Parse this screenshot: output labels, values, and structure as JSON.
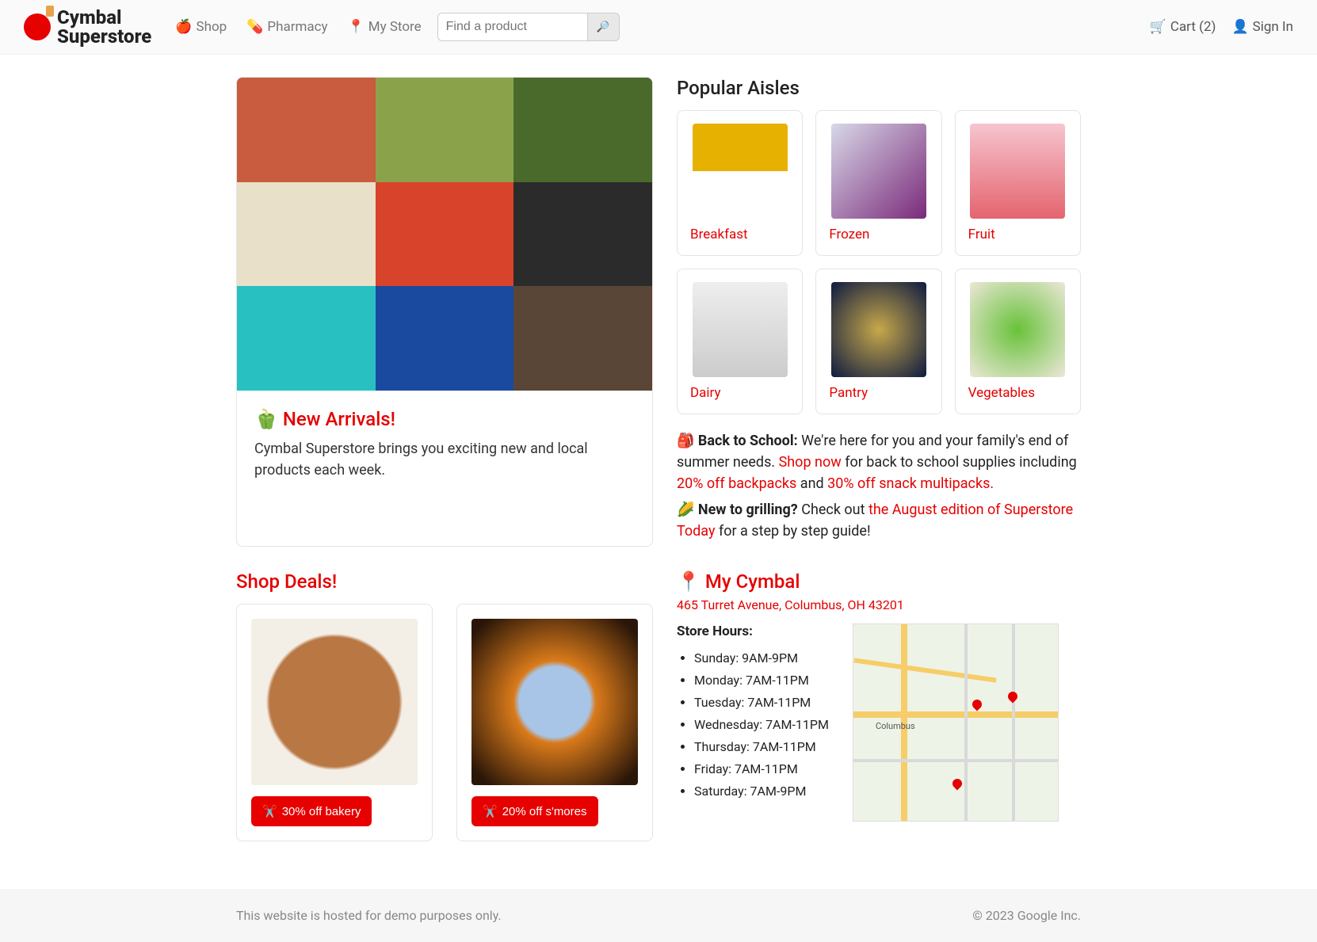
{
  "brand": {
    "line1": "Cymbal",
    "line2": "Superstore"
  },
  "nav": {
    "shop": {
      "icon": "🍎",
      "label": "Shop"
    },
    "pharmacy": {
      "icon": "💊",
      "label": "Pharmacy"
    },
    "store": {
      "icon": "📍",
      "label": "My Store"
    }
  },
  "search": {
    "placeholder": "Find a product",
    "button_icon": "🔎"
  },
  "header_right": {
    "cart": {
      "icon": "🛒",
      "label": "Cart (2)"
    },
    "signin": {
      "icon": "👤",
      "label": "Sign In"
    }
  },
  "hero": {
    "title_icon": "🫑",
    "title": "New Arrivals!",
    "desc": "Cymbal Superstore brings you exciting new and local products each week."
  },
  "aisles": {
    "title": "Popular Aisles",
    "items": [
      {
        "label": "Breakfast",
        "bg": "bg-breakfast"
      },
      {
        "label": "Frozen",
        "bg": "bg-frozen"
      },
      {
        "label": "Fruit",
        "bg": "bg-fruit"
      },
      {
        "label": "Dairy",
        "bg": "bg-dairy"
      },
      {
        "label": "Pantry",
        "bg": "bg-pantry"
      },
      {
        "label": "Vegetables",
        "bg": "bg-veg"
      }
    ]
  },
  "promo": {
    "p1_icon": "🎒",
    "p1_bold": "Back to School:",
    "p1_a": "We're here for you and your family's end of summer needs. ",
    "p1_link1": "Shop now",
    "p1_b": " for back to school supplies including ",
    "p1_link2": "20% off backpacks",
    "p1_c": " and ",
    "p1_link3": "30% off snack multipacks.",
    "p2_icon": "🌽",
    "p2_bold": "New to grilling?",
    "p2_a": " Check out ",
    "p2_link": "the August edition of Superstore Today",
    "p2_b": " for a step by step guide!"
  },
  "deals": {
    "title": "Shop Deals!",
    "items": [
      {
        "icon": "✂️",
        "label": "30% off bakery",
        "bg": "bg-pie"
      },
      {
        "icon": "✂️",
        "label": "20% off s'mores",
        "bg": "bg-smores"
      }
    ]
  },
  "mycymbal": {
    "icon": "📍",
    "title": "My Cymbal",
    "address": "465 Turret Avenue, Columbus, OH 43201",
    "hours_label": "Store Hours:",
    "hours": [
      "Sunday: 9AM-9PM",
      "Monday: 7AM-11PM",
      "Tuesday: 7AM-11PM",
      "Wednesday: 7AM-11PM",
      "Thursday: 7AM-11PM",
      "Friday: 7AM-11PM",
      "Saturday: 7AM-9PM"
    ],
    "map_city": "Columbus"
  },
  "footer": {
    "left": "This website is hosted for demo purposes only.",
    "right": "© 2023 Google Inc."
  }
}
